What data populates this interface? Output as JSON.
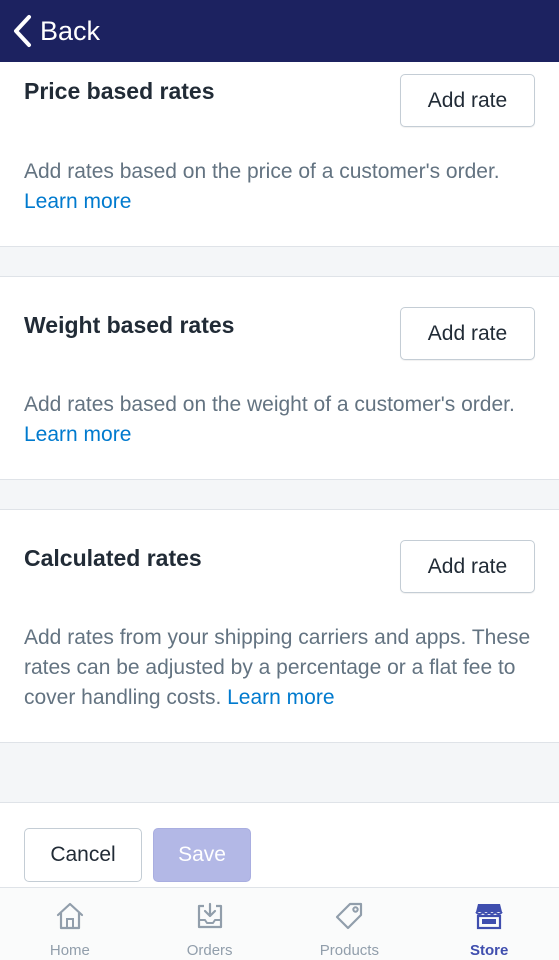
{
  "header": {
    "back_label": "Back"
  },
  "sections": [
    {
      "title": "Price based rates",
      "button_label": "Add rate",
      "description": "Add rates based on the price of a customer's order.",
      "link_label": "Learn more"
    },
    {
      "title": "Weight based rates",
      "button_label": "Add rate",
      "description": "Add rates based on the weight of a customer's order.",
      "link_label": "Learn more"
    },
    {
      "title": "Calculated rates",
      "button_label": "Add rate",
      "description": "Add rates from your shipping carriers and apps. These rates can be adjusted by a percentage or a flat fee to cover handling costs.",
      "link_label": "Learn more"
    }
  ],
  "footer": {
    "cancel_label": "Cancel",
    "save_label": "Save"
  },
  "tabbar": {
    "items": [
      {
        "label": "Home",
        "icon": "home-icon"
      },
      {
        "label": "Orders",
        "icon": "orders-icon"
      },
      {
        "label": "Products",
        "icon": "products-icon"
      },
      {
        "label": "Store",
        "icon": "store-icon",
        "active": true
      }
    ]
  },
  "colors": {
    "header_bg": "#1c2260",
    "link": "#007ace",
    "save_disabled": "#b3b8e6",
    "tab_active": "#3f4eae",
    "tab_inactive": "#919eab"
  }
}
